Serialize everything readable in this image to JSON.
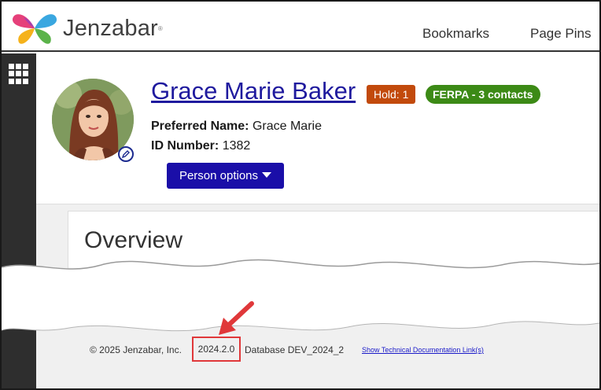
{
  "header": {
    "brand_name": "Jenzabar",
    "nav": [
      {
        "label": "Bookmarks"
      },
      {
        "label": "Page Pins"
      }
    ]
  },
  "person": {
    "name": "Grace Marie Baker",
    "hold_badge": "Hold: 1",
    "ferpa_badge": "FERPA - 3 contacts",
    "preferred_label": "Preferred Name:",
    "preferred_value": "Grace Marie",
    "id_label": "ID Number:",
    "id_value": "1382",
    "options_button": "Person options"
  },
  "main": {
    "overview_title": "Overview"
  },
  "footer": {
    "copyright": "© 2025 Jenzabar, Inc.",
    "version": "2024.2.0",
    "database": "Database DEV_2024_2",
    "tech_link": "Show Technical Documentation Link(s)"
  },
  "colors": {
    "brand_blue": "#1a0ea8",
    "name_link": "#1f1a9e",
    "hold": "#c24a0c",
    "ferpa": "#3c8a16",
    "highlight_red": "#e0383a",
    "rail": "#2e2e2e"
  },
  "icons": [
    "app-grid-icon",
    "edit-photo-icon",
    "caret-down-icon",
    "callout-arrow-icon"
  ]
}
